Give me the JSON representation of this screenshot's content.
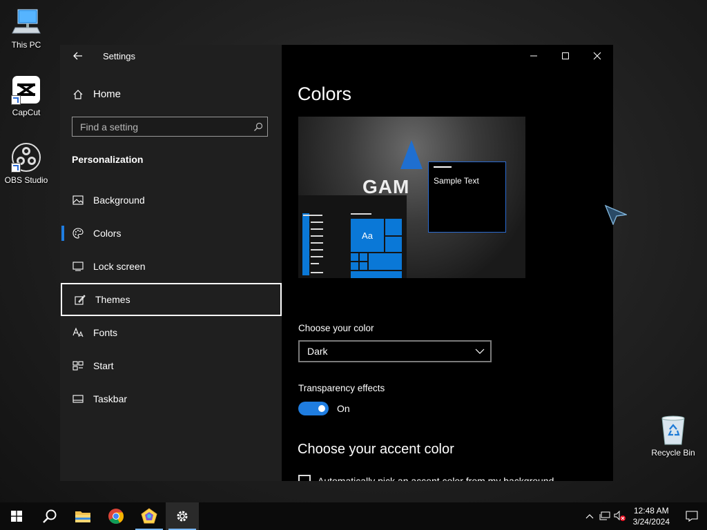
{
  "desktop": {
    "icons": [
      {
        "label": "This PC"
      },
      {
        "label": "CapCut"
      },
      {
        "label": "OBS Studio"
      }
    ],
    "recycle_bin": "Recycle Bin"
  },
  "window": {
    "app_title": "Settings",
    "home_label": "Home",
    "search_placeholder": "Find a setting",
    "section_title": "Personalization",
    "nav_items": [
      {
        "label": "Background",
        "icon": "image-icon"
      },
      {
        "label": "Colors",
        "icon": "palette-icon",
        "selected": true
      },
      {
        "label": "Lock screen",
        "icon": "lock-screen-icon"
      },
      {
        "label": "Themes",
        "icon": "themes-icon",
        "focused": true
      },
      {
        "label": "Fonts",
        "icon": "fonts-icon"
      },
      {
        "label": "Start",
        "icon": "start-icon"
      },
      {
        "label": "Taskbar",
        "icon": "taskbar-icon"
      }
    ]
  },
  "content": {
    "page_title": "Colors",
    "preview": {
      "sample_text": "Sample Text",
      "tile_label": "Aa",
      "logo_text": "GAM"
    },
    "choose_color_label": "Choose your color",
    "choose_color_value": "Dark",
    "transparency_label": "Transparency effects",
    "transparency_state": "On",
    "accent_title": "Choose your accent color",
    "auto_accent_label": "Automatically pick an accent color from my background"
  },
  "colors": {
    "accent": "#1f7de0",
    "sidebar_bg": "#1f1f1f",
    "content_bg": "#000000"
  },
  "taskbar": {
    "time": "12:48 AM",
    "date": "3/24/2024"
  }
}
